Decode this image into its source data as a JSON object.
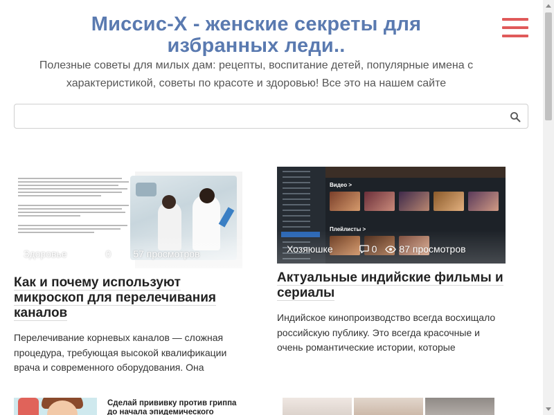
{
  "header": {
    "site_title": "Миссис-Х - женские секреты для избранных леди..",
    "tagline": "Полезные советы для милых дам: рецепты, воспитание детей, популярные имена с характеристикой, советы по красоте и здоровью! Все это на нашем сайте",
    "menu_icon": "hamburger-icon",
    "accent_color": "#e05a5a",
    "title_color": "#5a7ab0"
  },
  "search": {
    "value": "",
    "placeholder": "",
    "icon": "search-icon"
  },
  "articles": [
    {
      "category": "Здоровье",
      "comments": "0",
      "views": "57 просмотров",
      "title": "Как и почему используют микроскоп для перелечивания каналов",
      "excerpt": "Перелечивание корневых каналов — сложная процедура, требующая высокой квалификации врача и современного оборудования. Она"
    },
    {
      "category": "Хозяюшке",
      "comments": "0",
      "views": "87 просмотров",
      "title": "Актуальные индийские фильмы и сериалы",
      "excerpt": "Индийское кинопроизводство всегда восхищало российскую публику. Это всегда красочные и очень романтические истории, которые",
      "thumb_labels": {
        "video": "Видео >",
        "playlists": "Плейлисты >"
      }
    }
  ],
  "bottom_cards": [
    {
      "teaser_text": "Сделай прививку против гриппа до начала эпидемического сезона"
    },
    {}
  ],
  "scrollbar": {
    "position_fraction": 0.0
  }
}
